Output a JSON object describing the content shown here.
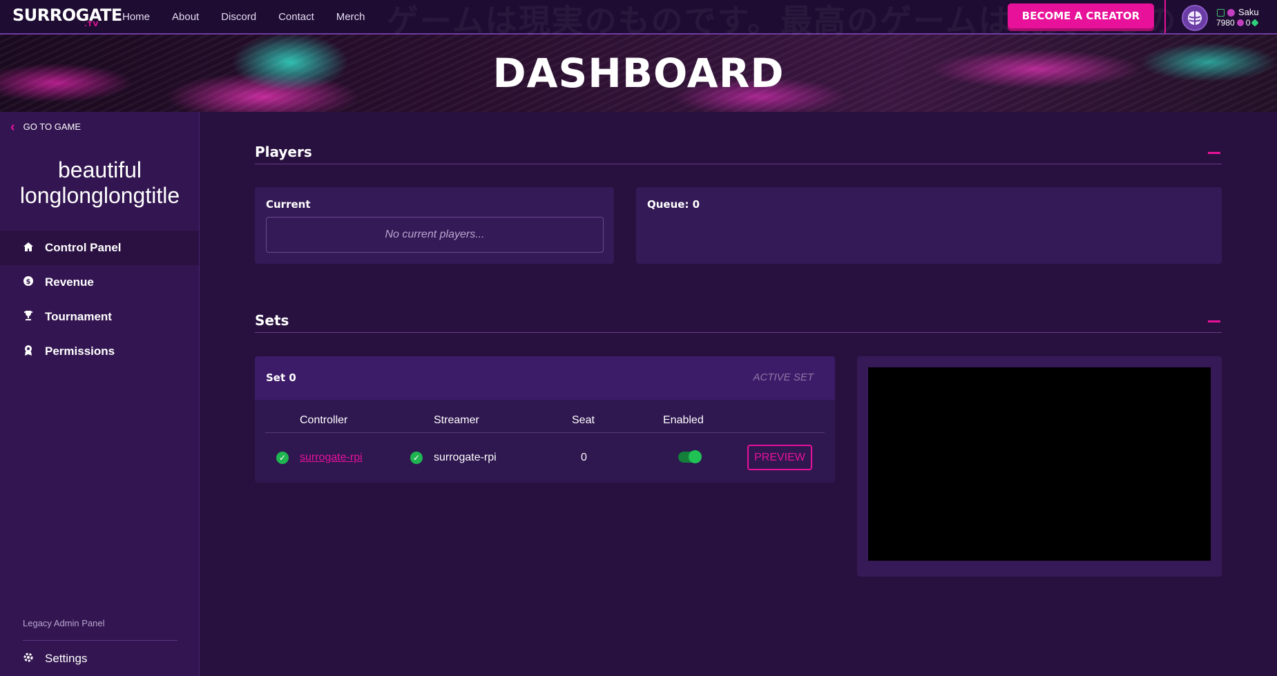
{
  "header": {
    "logo": "SURROGATE",
    "logo_sub": ".TV",
    "nav": [
      "Home",
      "About",
      "Discord",
      "Contact",
      "Merch"
    ],
    "ghost_text": "ゲームは現実のものです。最高のゲームは現実のもの",
    "creator_button": "BECOME A CREATOR",
    "user": {
      "name": "Saku",
      "points": "7980",
      "gems": "0"
    }
  },
  "banner": {
    "title": "DASHBOARD"
  },
  "sidebar": {
    "back_label": "GO TO GAME",
    "game_title": "beautiful longlonglongtitle",
    "items": [
      {
        "label": "Control Panel",
        "icon": "home-icon",
        "active": true
      },
      {
        "label": "Revenue",
        "icon": "dollar-icon",
        "active": false
      },
      {
        "label": "Tournament",
        "icon": "trophy-icon",
        "active": false
      },
      {
        "label": "Permissions",
        "icon": "badge-icon",
        "active": false
      }
    ],
    "legacy_link": "Legacy Admin Panel",
    "settings_label": "Settings"
  },
  "players": {
    "title": "Players",
    "current_label": "Current",
    "empty_text": "No current players...",
    "queue_label": "Queue: 0"
  },
  "sets": {
    "title": "Sets",
    "set_name": "Set 0",
    "active_label": "ACTIVE SET",
    "columns": [
      "Controller",
      "Streamer",
      "Seat",
      "Enabled"
    ],
    "rows": [
      {
        "controller": "surrogate-rpi",
        "streamer": "surrogate-rpi",
        "seat": "0",
        "enabled": true
      }
    ],
    "preview_button": "PREVIEW"
  },
  "colors": {
    "accent": "#e8129a",
    "background": "#28113f",
    "sidebar": "#331651",
    "success": "#1fb550"
  }
}
